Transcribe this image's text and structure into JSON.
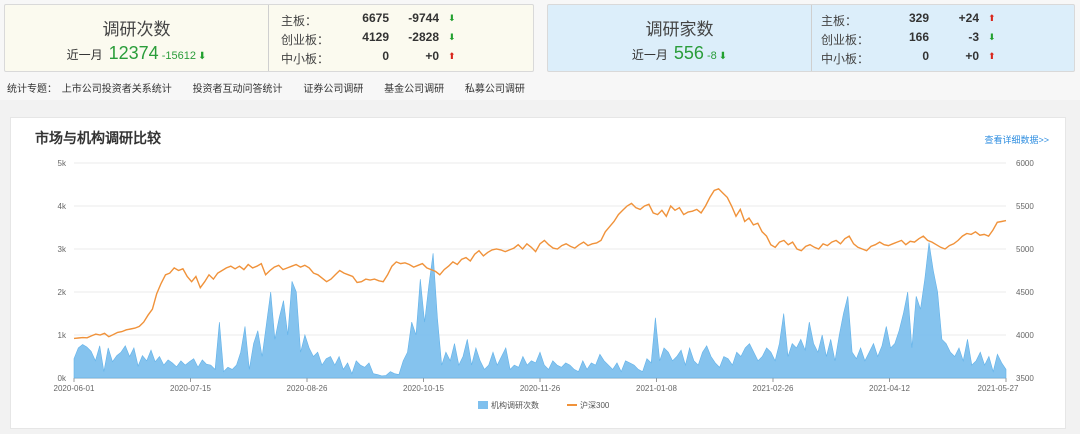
{
  "research_count": {
    "title": "调研次数",
    "period_label": "近一月",
    "value": "12374",
    "change": "-15612",
    "boards": [
      {
        "label": "主板：",
        "value": "6675",
        "change": "-9744",
        "dir": "down"
      },
      {
        "label": "创业板：",
        "value": "4129",
        "change": "-2828",
        "dir": "down"
      },
      {
        "label": "中小板：",
        "value": "0",
        "change": "+0",
        "dir": "up"
      }
    ]
  },
  "research_firms": {
    "title": "调研家数",
    "period_label": "近一月",
    "value": "556",
    "change": "-8",
    "boards": [
      {
        "label": "主板：",
        "value": "329",
        "change": "+24",
        "dir": "up"
      },
      {
        "label": "创业板：",
        "value": "166",
        "change": "-3",
        "dir": "down"
      },
      {
        "label": "中小板：",
        "value": "0",
        "change": "+0",
        "dir": "up"
      }
    ]
  },
  "topics": {
    "label": "统计专题：",
    "items": [
      "上市公司投资者关系统计",
      "投资者互动问答统计",
      "证券公司调研",
      "基金公司调研",
      "私募公司调研"
    ]
  },
  "panel": {
    "title": "市场与机构调研比较",
    "more_link": "查看详细数据>>"
  },
  "colors": {
    "bar": "#7fc0ee",
    "bar_edge": "#5aaee8",
    "line": "#f0923a",
    "up": "#d9261c",
    "down": "#22a02f"
  },
  "chart_data": {
    "type": "area",
    "x_ticks": [
      "2020-06-01",
      "2020-07-15",
      "2020-08-26",
      "2020-10-15",
      "2020-11-26",
      "2021-01-08",
      "2021-02-26",
      "2021-04-12",
      "2021-05-27"
    ],
    "y_left": {
      "ticks": [
        "0k",
        "1k",
        "2k",
        "3k",
        "4k",
        "5k"
      ],
      "range": [
        0,
        5000
      ]
    },
    "y_right": {
      "ticks": [
        "3500",
        "4000",
        "4500",
        "5000",
        "5500",
        "6000"
      ],
      "range": [
        3500,
        6000
      ]
    },
    "legend": [
      "机构调研次数",
      "沪深300"
    ],
    "series": [
      {
        "name": "机构调研次数",
        "axis": "left",
        "kind": "area",
        "values": [
          450,
          700,
          780,
          720,
          620,
          400,
          750,
          150,
          700,
          380,
          520,
          600,
          750,
          500,
          700,
          280,
          520,
          400,
          650,
          380,
          500,
          300,
          420,
          350,
          260,
          400,
          300,
          380,
          450,
          250,
          420,
          320,
          300,
          200,
          1300,
          150,
          250,
          200,
          300,
          600,
          1200,
          200,
          800,
          1100,
          500,
          1250,
          2000,
          900,
          1400,
          1800,
          1000,
          2250,
          2000,
          600,
          1000,
          700,
          500,
          600,
          300,
          450,
          500,
          300,
          500,
          200,
          350,
          100,
          400,
          300,
          250,
          350,
          100,
          80,
          50,
          60,
          150,
          100,
          80,
          400,
          600,
          1300,
          1000,
          2300,
          1300,
          2150,
          2900,
          1400,
          300,
          600,
          400,
          800,
          300,
          500,
          900,
          300,
          700,
          400,
          200,
          300,
          600,
          300,
          500,
          700,
          200,
          300,
          250,
          500,
          300,
          400,
          350,
          600,
          300,
          200,
          400,
          300,
          250,
          350,
          300,
          200,
          150,
          400,
          200,
          350,
          300,
          550,
          400,
          300,
          200,
          350,
          150,
          400,
          350,
          300,
          200,
          150,
          450,
          350,
          1400,
          400,
          700,
          600,
          400,
          500,
          650,
          300,
          700,
          400,
          300,
          600,
          750,
          500,
          350,
          250,
          500,
          450,
          300,
          600,
          500,
          700,
          800,
          600,
          400,
          500,
          700,
          600,
          400,
          800,
          1500,
          500,
          800,
          700,
          900,
          650,
          1300,
          800,
          600,
          1000,
          500,
          900,
          400,
          1000,
          1500,
          1900,
          600,
          450,
          700,
          400,
          600,
          800,
          500,
          750,
          1200,
          700,
          800,
          1100,
          1500,
          2000,
          700,
          1900,
          1600,
          2300,
          3150,
          2500,
          2000,
          900,
          800,
          600,
          500,
          700,
          400,
          900,
          300,
          400,
          600,
          300,
          500,
          150,
          550,
          350,
          200
        ]
      },
      {
        "name": "沪深300",
        "axis": "right",
        "kind": "line",
        "values": [
          3960,
          3965,
          3970,
          3968,
          3990,
          4010,
          4000,
          4020,
          3980,
          4005,
          4030,
          4040,
          4060,
          4070,
          4080,
          4100,
          4150,
          4230,
          4300,
          4480,
          4600,
          4700,
          4720,
          4780,
          4750,
          4770,
          4680,
          4620,
          4680,
          4550,
          4620,
          4700,
          4650,
          4720,
          4750,
          4780,
          4800,
          4770,
          4800,
          4760,
          4820,
          4780,
          4800,
          4830,
          4700,
          4750,
          4790,
          4810,
          4760,
          4780,
          4800,
          4820,
          4790,
          4810,
          4780,
          4720,
          4700,
          4660,
          4620,
          4650,
          4700,
          4750,
          4720,
          4700,
          4680,
          4610,
          4620,
          4650,
          4640,
          4650,
          4630,
          4620,
          4700,
          4800,
          4850,
          4830,
          4840,
          4820,
          4790,
          4810,
          4830,
          4780,
          4760,
          4740,
          4700,
          4760,
          4800,
          4850,
          4820,
          4880,
          4900,
          4860,
          4940,
          4980,
          4920,
          4960,
          4990,
          5000,
          4990,
          4970,
          4990,
          5010,
          5050,
          5000,
          5060,
          5020,
          4970,
          5060,
          5100,
          5050,
          5010,
          5000,
          5040,
          5060,
          5030,
          5010,
          5050,
          5080,
          5040,
          5060,
          5070,
          5100,
          5200,
          5260,
          5320,
          5400,
          5450,
          5500,
          5530,
          5480,
          5460,
          5500,
          5520,
          5420,
          5400,
          5450,
          5380,
          5500,
          5450,
          5480,
          5400,
          5430,
          5440,
          5460,
          5420,
          5500,
          5600,
          5680,
          5700,
          5650,
          5600,
          5500,
          5380,
          5460,
          5320,
          5360,
          5280,
          5300,
          5200,
          5150,
          5050,
          5020,
          5080,
          5100,
          5050,
          5080,
          5000,
          4980,
          5030,
          5050,
          5020,
          5000,
          5060,
          5040,
          5080,
          5100,
          5060,
          5120,
          5150,
          5060,
          5020,
          5000,
          4980,
          5030,
          5050,
          5080,
          5050,
          5040,
          5060,
          5080,
          5100,
          5050,
          5090,
          5080,
          5120,
          5150,
          5100,
          5080,
          5050,
          5020,
          5000,
          5040,
          5060,
          5100,
          5150,
          5180,
          5170,
          5200,
          5160,
          5170,
          5150,
          5220,
          5310,
          5320,
          5330
        ]
      }
    ]
  }
}
